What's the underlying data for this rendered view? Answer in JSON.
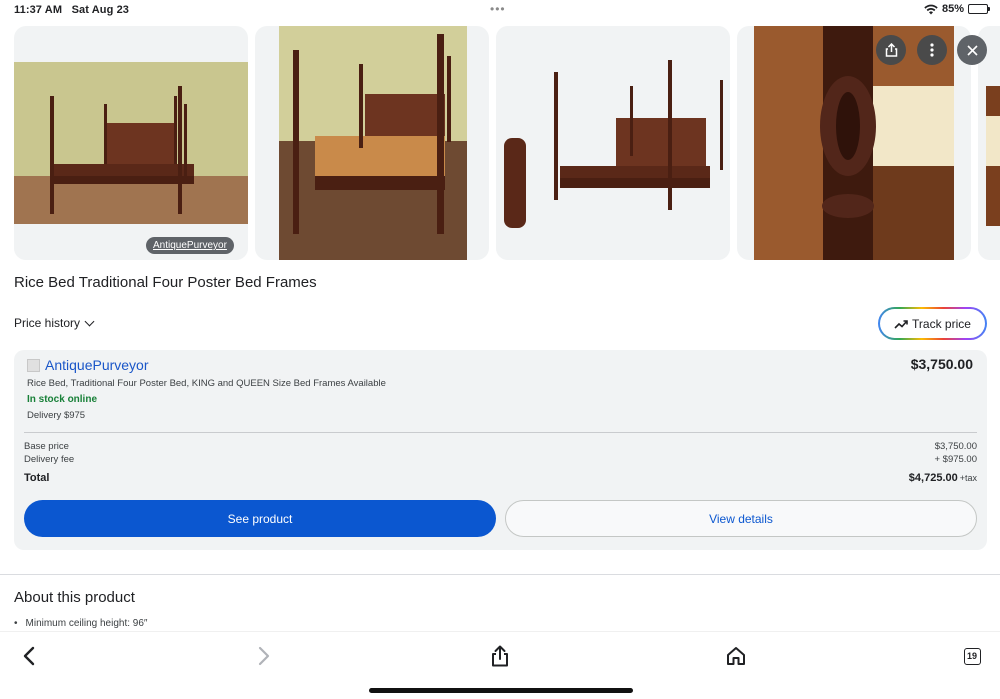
{
  "status_bar": {
    "time": "11:37 AM",
    "date": "Sat Aug 23",
    "battery": "85%",
    "battery_level": 0.85
  },
  "gallery": {
    "source_chip": "AntiquePurveyor",
    "images": [
      "bed-photo-1",
      "bed-photo-2",
      "bed-photo-3",
      "bedpost-detail-photo",
      "partial-photo"
    ]
  },
  "top_actions": {
    "share_icon": "share-icon",
    "more_icon": "more-vert-icon",
    "close_icon": "close-icon"
  },
  "product": {
    "title": "Rice Bed Traditional Four Poster Bed Frames"
  },
  "price_history": {
    "label": "Price history"
  },
  "track_price": {
    "label": "Track price"
  },
  "offer": {
    "seller": "AntiquePurveyor",
    "price": "$3,750.00",
    "description": "Rice Bed, Traditional Four Poster Bed, KING and QUEEN Size Bed Frames Available",
    "stock": "In stock online",
    "delivery": "Delivery $975",
    "base_label": "Base price",
    "base_value": "$3,750.00",
    "fee_label": "Delivery fee",
    "fee_value": "+ $975.00",
    "total_label": "Total",
    "total_value": "$4,725.00",
    "tax_note": "+tax",
    "see_product": "See product",
    "view_details": "View details"
  },
  "about": {
    "title": "About this product",
    "bullets": [
      "Minimum ceiling height: 96″"
    ]
  },
  "toolbar": {
    "tab_count": "19"
  },
  "colors": {
    "accent": "#0b57d0",
    "link": "#1a56c8",
    "in_stock": "#188038",
    "card_bg": "#f1f3f4"
  }
}
